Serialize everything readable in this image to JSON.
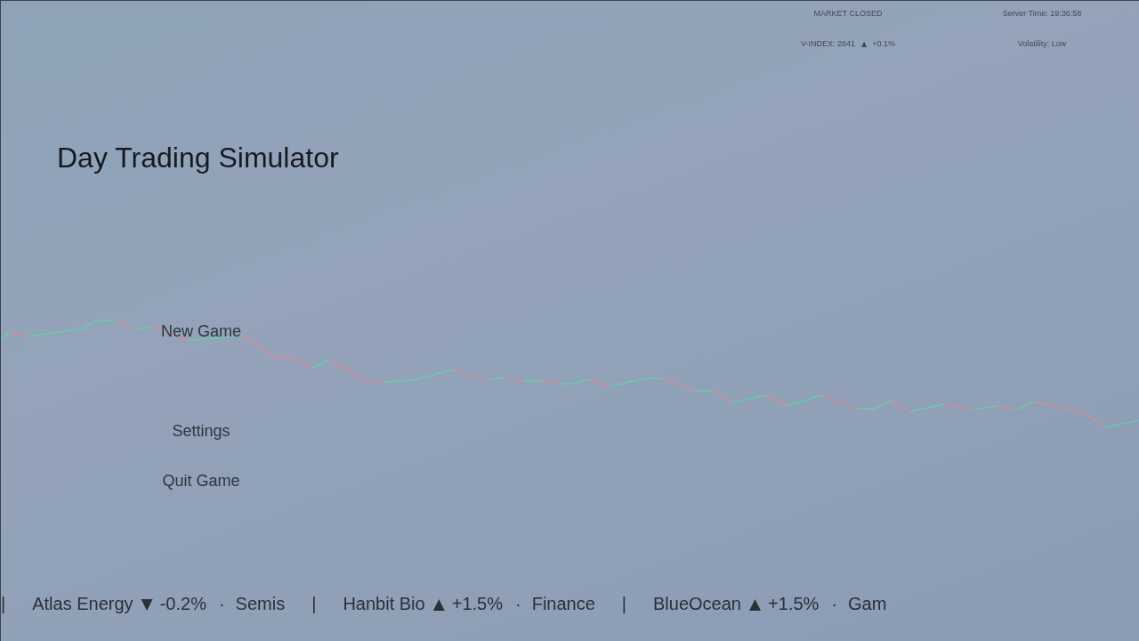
{
  "status": {
    "market_state": "MARKET CLOSED",
    "server_time": "Server Time: 19:36:58",
    "v_index": {
      "label": "V-INDEX: 2641",
      "arrow": "▲",
      "change": "+0.1%"
    },
    "volatility": "Volatility: Low"
  },
  "title": "Day Trading Simulator",
  "menu": [
    {
      "label": "New Game"
    },
    {
      "label": "Settings"
    },
    {
      "label": "Quit Game"
    }
  ],
  "ticker": [
    {
      "kind": "divider",
      "text": "|"
    },
    {
      "kind": "quote",
      "name": "Atlas Energy",
      "arrow": "▼",
      "change": "-0.2%",
      "dot": "·",
      "sector": "Semis"
    },
    {
      "kind": "divider",
      "text": "|"
    },
    {
      "kind": "quote",
      "name": "Hanbit Bio",
      "arrow": "▲",
      "change": "+1.5%",
      "dot": "·",
      "sector": "Finance"
    },
    {
      "kind": "divider",
      "text": "|"
    },
    {
      "kind": "quote",
      "name": "BlueOcean",
      "arrow": "▲",
      "change": "+1.5%",
      "dot": "·",
      "sector": "Gam"
    }
  ]
}
